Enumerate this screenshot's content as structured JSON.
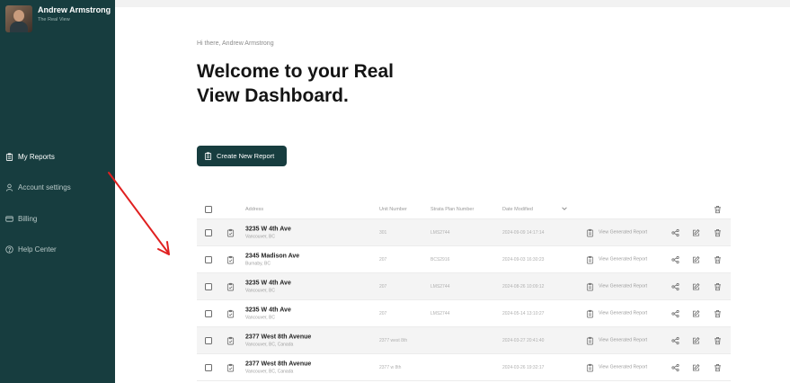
{
  "user": {
    "name": "Andrew Armstrong",
    "org": "The Real View"
  },
  "nav": [
    {
      "label": "My Reports",
      "icon": "clipboard-icon",
      "active": true
    },
    {
      "label": "Account settings",
      "icon": "user-icon",
      "active": false
    },
    {
      "label": "Billing",
      "icon": "card-icon",
      "active": false
    },
    {
      "label": "Help Center",
      "icon": "help-icon",
      "active": false
    }
  ],
  "main": {
    "greeting": "Hi there, Andrew Armstrong",
    "title": "Welcome to your Real View Dashboard.",
    "create_button": "Create New Report"
  },
  "table": {
    "headers": {
      "address": "Address",
      "unit": "Unit Number",
      "strata": "Strata Plan Number",
      "date": "Date Modified"
    },
    "report_label": "View Generated Report",
    "rows": [
      {
        "address": "3235 W 4th Ave",
        "city": "Vancouver, BC",
        "unit": "301",
        "strata": "LMS2744",
        "date": "2024-09-09 14:17:14"
      },
      {
        "address": "2345 Madison Ave",
        "city": "Burnaby, BC",
        "unit": "207",
        "strata": "BCS2916",
        "date": "2024-09-03 16:30:23"
      },
      {
        "address": "3235 W 4th Ave",
        "city": "Vancouver, BC",
        "unit": "207",
        "strata": "LMS2744",
        "date": "2024-08-26 10:09:12"
      },
      {
        "address": "3235 W 4th Ave",
        "city": "Vancouver, BC",
        "unit": "207",
        "strata": "LMS2744",
        "date": "2024-05-14 13:10:27"
      },
      {
        "address": "2377 West 8th Avenue",
        "city": "Vancouver, BC, Canada",
        "unit": "2377 west 8th",
        "strata": "",
        "date": "2024-03-27 20:41:40"
      },
      {
        "address": "2377 West 8th Avenue",
        "city": "Vancouver, BC, Canada",
        "unit": "2377 w 8th",
        "strata": "",
        "date": "2024-03-26 19:32:17"
      }
    ]
  },
  "colors": {
    "sidebar": "#173d3f",
    "accent": "#173d3f",
    "annotation": "#e02020"
  }
}
